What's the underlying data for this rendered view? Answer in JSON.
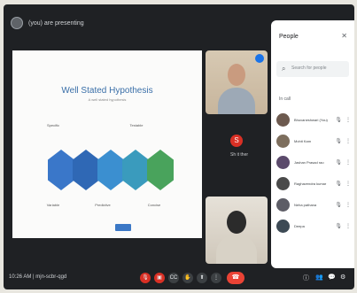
{
  "meeting": {
    "presenting_label": "(you) are presenting",
    "info": "10:26 AM | mjn-scbr-qgd"
  },
  "slide": {
    "title": "Well Stated Hypothesis",
    "subtitle": "A well stated hypothesis",
    "labels": [
      "Specific",
      "Testable",
      "Variable",
      "Predictive",
      "Concise"
    ]
  },
  "tiles": {
    "mini_initial": "S",
    "mini_name": "Sh it ther"
  },
  "people_panel": {
    "title": "People",
    "search_placeholder": "Search for people",
    "section_label": "In call",
    "participants": [
      {
        "name": "Bhuvaneshwari (You)",
        "color": "#6d5a4f"
      },
      {
        "name": "Mohit Kam",
        "color": "#7d6e5d"
      },
      {
        "name": "Jashan Prasad rao",
        "color": "#5b4a6b"
      },
      {
        "name": "Raghavendra kumar",
        "color": "#4a4a4a"
      },
      {
        "name": "Neha pathana",
        "color": "#5d5d66"
      },
      {
        "name": "Deepa",
        "color": "#3d4a55"
      }
    ]
  },
  "colors": {
    "accent": "#1a73e8",
    "danger": "#ea4335"
  },
  "icons": {
    "mic": "mic-icon",
    "camera": "camera-icon",
    "captions": "captions-icon",
    "raise_hand": "hand-icon",
    "present": "present-icon",
    "more": "more-icon",
    "end_call": "phone-icon"
  }
}
